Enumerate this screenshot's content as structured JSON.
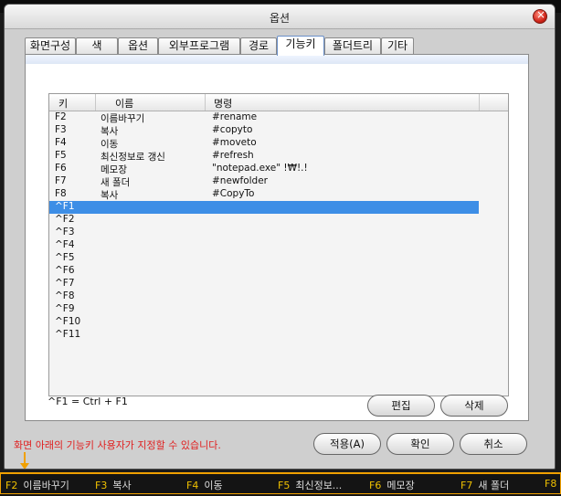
{
  "dialog": {
    "title": "옵션",
    "tabs": [
      "화면구성",
      "색",
      "옵션",
      "외부프로그램",
      "경로",
      "기능키",
      "폴더트리",
      "기타"
    ],
    "active_tab": "기능키"
  },
  "list": {
    "columns": [
      "키",
      "이름",
      "명령"
    ],
    "rows": [
      {
        "key": "F2",
        "name": "이름바꾸기",
        "cmd": "#rename"
      },
      {
        "key": "F3",
        "name": "복사",
        "cmd": "#copyto"
      },
      {
        "key": "F4",
        "name": "이동",
        "cmd": "#moveto"
      },
      {
        "key": "F5",
        "name": "최신정보로 갱신",
        "cmd": "#refresh"
      },
      {
        "key": "F6",
        "name": "메모장",
        "cmd": "\"notepad.exe\" !₩!.!"
      },
      {
        "key": "F7",
        "name": "새 폴더",
        "cmd": "#newfolder"
      },
      {
        "key": "F8",
        "name": "복사",
        "cmd": "#CopyTo"
      },
      {
        "key": "^F1",
        "name": "",
        "cmd": ""
      },
      {
        "key": "^F2",
        "name": "",
        "cmd": ""
      },
      {
        "key": "^F3",
        "name": "",
        "cmd": ""
      },
      {
        "key": "^F4",
        "name": "",
        "cmd": ""
      },
      {
        "key": "^F5",
        "name": "",
        "cmd": ""
      },
      {
        "key": "^F6",
        "name": "",
        "cmd": ""
      },
      {
        "key": "^F7",
        "name": "",
        "cmd": ""
      },
      {
        "key": "^F8",
        "name": "",
        "cmd": ""
      },
      {
        "key": "^F9",
        "name": "",
        "cmd": ""
      },
      {
        "key": "^F10",
        "name": "",
        "cmd": ""
      },
      {
        "key": "^F11",
        "name": "",
        "cmd": ""
      }
    ],
    "selected_key": "^F1"
  },
  "note": "^F1 = Ctrl + F1",
  "buttons": {
    "edit": "편집",
    "delete": "삭제",
    "apply": "적용(A)",
    "ok": "확인",
    "cancel": "취소"
  },
  "hint": "화면 아래의 기능키 사용자가 지정할 수 있습니다.",
  "fkey_bar": [
    {
      "key": "F2",
      "label": "이름바꾸기"
    },
    {
      "key": "F3",
      "label": "복사"
    },
    {
      "key": "F4",
      "label": "이동"
    },
    {
      "key": "F5",
      "label": "최신정보..."
    },
    {
      "key": "F6",
      "label": "메모장"
    },
    {
      "key": "F7",
      "label": "새 폴더"
    },
    {
      "key": "F8",
      "label": ""
    }
  ],
  "colors": {
    "accent": "#f0a000",
    "selection": "#3d8ee6",
    "hint": "#e02020"
  }
}
